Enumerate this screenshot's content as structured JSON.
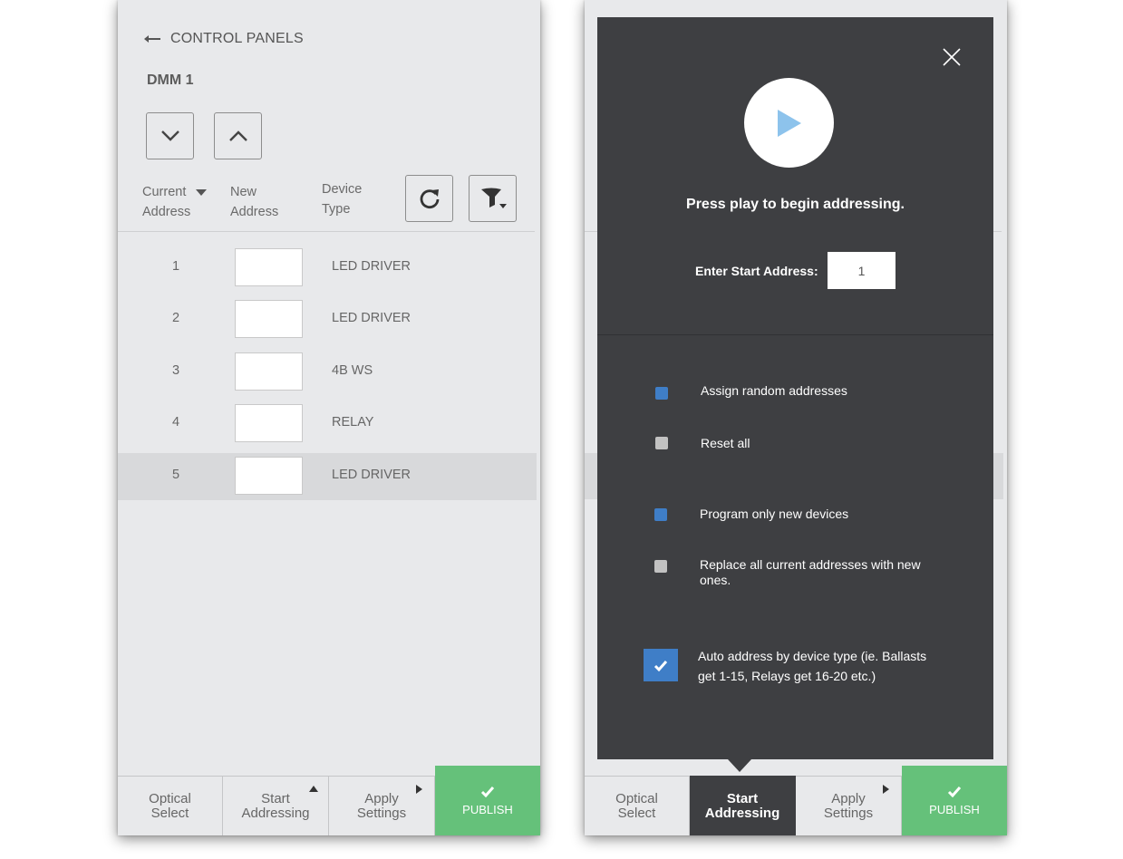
{
  "left_screen": {
    "back_label": "CONTROL PANELS",
    "title": "DMM 1",
    "columns": {
      "current_address": [
        "Current",
        "Address"
      ],
      "new_address": [
        "New",
        "Address"
      ],
      "device_type": [
        "Device",
        "Type"
      ]
    },
    "rows": [
      {
        "num": "1",
        "new_address": "",
        "device_type": "LED DRIVER",
        "selected": false
      },
      {
        "num": "2",
        "new_address": "",
        "device_type": "LED DRIVER",
        "selected": false
      },
      {
        "num": "3",
        "new_address": "",
        "device_type": "4B WS",
        "selected": false
      },
      {
        "num": "4",
        "new_address": "",
        "device_type": "RELAY",
        "selected": false
      },
      {
        "num": "5",
        "new_address": "",
        "device_type": "LED DRIVER",
        "selected": true
      }
    ]
  },
  "bottom_bar": {
    "optical_select": [
      "Optical",
      "Select"
    ],
    "start_addressing": [
      "Start",
      "Addressing"
    ],
    "apply_settings": [
      "Apply",
      "Settings"
    ],
    "publish": "PUBLISH"
  },
  "modal": {
    "press_text": "Press play to begin addressing.",
    "start_address_label": "Enter Start Address:",
    "start_address_value": "1",
    "options": [
      {
        "label": "Assign random addresses",
        "state": "on"
      },
      {
        "label": "Reset all",
        "state": "off"
      },
      {
        "label": "Program only new devices",
        "state": "on"
      },
      {
        "label": "Replace all current addresses with new ones.",
        "state": "off"
      }
    ],
    "auto_address": {
      "label": "Auto address by device type (ie. Ballasts get 1-15, Relays get 16-20 etc.)",
      "checked": true
    }
  },
  "colors": {
    "background": "#e8e9eb",
    "modal": "#3e3f42",
    "accent_blue": "#3f7ec7",
    "publish_green": "#65c17a",
    "play_icon": "#8dc3ec"
  },
  "icons": [
    "arrow-left-icon",
    "chevron-down-icon",
    "chevron-up-icon",
    "sort-down-icon",
    "refresh-icon",
    "filter-icon",
    "check-icon",
    "close-icon",
    "play-icon"
  ]
}
